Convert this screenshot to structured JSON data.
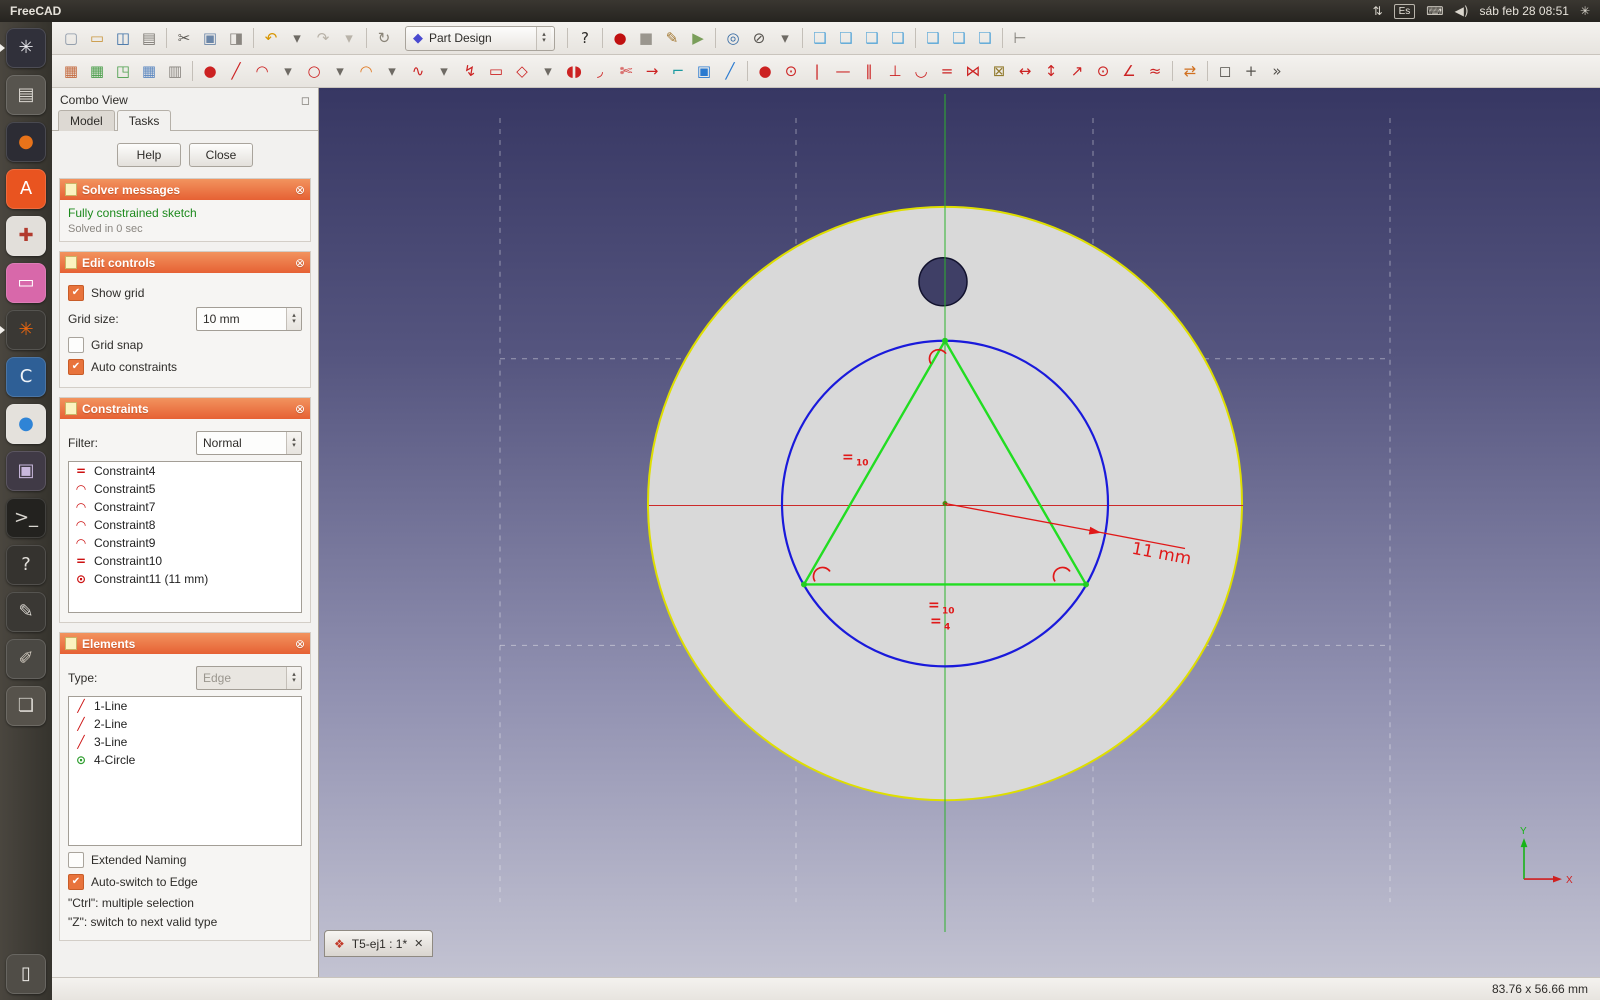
{
  "system_bar": {
    "app_title": "FreeCAD",
    "network_glyph": "⇅",
    "keyboard_layout": "Es",
    "keyboard_glyph": "⌨",
    "volume_glyph": "◀)",
    "clock": "sáb feb 28 08:51",
    "session_glyph": "✳"
  },
  "dock": {
    "items": [
      {
        "name": "freecad-launcher",
        "icon": "freecad-icon",
        "glyph": "✳",
        "fg": "#e8e8ec",
        "bg": "#30303a",
        "running": true
      },
      {
        "name": "file-manager-launcher",
        "icon": "file-manager-icon",
        "glyph": "▤",
        "fg": "#d8d5cf",
        "bg": "#57544e",
        "running": false
      },
      {
        "name": "firefox-launcher",
        "icon": "firefox-icon",
        "glyph": "●",
        "fg": "#e8731a",
        "bg": "#2c2c34",
        "running": false
      },
      {
        "name": "software-center-launcher",
        "icon": "software-center-icon",
        "glyph": "A",
        "fg": "#ffffff",
        "bg": "#e95420",
        "running": false
      },
      {
        "name": "system-tools-launcher",
        "icon": "tools-icon",
        "glyph": "✚",
        "fg": "#b23b2e",
        "bg": "#e2dfda",
        "running": false
      },
      {
        "name": "media-app-launcher",
        "icon": "media-app-icon",
        "glyph": "▭",
        "fg": "#ffffff",
        "bg": "#d868aa",
        "running": false
      },
      {
        "name": "settings-gear-launcher",
        "icon": "gear-icon",
        "glyph": "✳",
        "fg": "#e8650f",
        "bg": "#3a3834",
        "running": true
      },
      {
        "name": "chromium-launcher",
        "icon": "chromium-icon",
        "glyph": "C",
        "fg": "#eef3f8",
        "bg": "#2e5f96",
        "running": false
      },
      {
        "name": "browser-launcher",
        "icon": "globe-icon",
        "glyph": "●",
        "fg": "#2f84d6",
        "bg": "#e4e1dc",
        "running": false
      },
      {
        "name": "screenshot-tool-launcher",
        "icon": "screenshot-icon",
        "glyph": "▣",
        "fg": "#c9b8dd",
        "bg": "#403a46",
        "running": false
      },
      {
        "name": "terminal-launcher",
        "icon": "terminal-icon",
        "glyph": ">_",
        "fg": "#d8d5cf",
        "bg": "#23221f",
        "running": false
      },
      {
        "name": "help-launcher",
        "icon": "help-icon",
        "glyph": "?",
        "fg": "#e2dfda",
        "bg": "#35332f",
        "running": false
      },
      {
        "name": "text-editor-launcher",
        "icon": "pencil-icon",
        "glyph": "✎",
        "fg": "#d8d5cf",
        "bg": "#3a3834",
        "running": false
      },
      {
        "name": "gimp-launcher",
        "icon": "paintbrush-icon",
        "glyph": "✐",
        "fg": "#cfc8bd",
        "bg": "#4a4843",
        "running": false
      },
      {
        "name": "workspace-switcher-launcher",
        "icon": "workspace-icon",
        "glyph": "❏",
        "fg": "#dad7d1",
        "bg": "#56524b",
        "running": false
      },
      {
        "name": "trash-launcher",
        "icon": "trash-icon",
        "glyph": "▯",
        "fg": "#eceae6",
        "bg": "#504d47",
        "running": false
      }
    ]
  },
  "toolbars": {
    "workbench_selector": {
      "icon_glyph": "◆",
      "value": "Part Design"
    },
    "main_a": [
      {
        "name": "new-document-button",
        "icon": "new-document-icon",
        "glyph": "▢",
        "color": "#8a96a6"
      },
      {
        "name": "open-document-button",
        "icon": "open-folder-icon",
        "glyph": "▭",
        "color": "#c9973f"
      },
      {
        "name": "save-document-button",
        "icon": "save-icon",
        "glyph": "◫",
        "color": "#3b6ea5"
      },
      {
        "name": "print-button",
        "icon": "printer-icon",
        "glyph": "▤",
        "color": "#7d7a74"
      },
      {
        "name": "cut-button",
        "icon": "scissors-icon",
        "glyph": "✂",
        "color": "#5a5752",
        "sep": true
      },
      {
        "name": "copy-button",
        "icon": "copy-icon",
        "glyph": "▣",
        "color": "#6b86a8"
      },
      {
        "name": "paste-button",
        "icon": "paste-icon",
        "glyph": "◨",
        "color": "#8a8680"
      },
      {
        "name": "undo-button",
        "icon": "undo-icon",
        "glyph": "↶",
        "color": "#d79500",
        "sep": true
      },
      {
        "name": "undo-menu-button",
        "icon": "chevron-down-icon",
        "glyph": "▾",
        "color": "#6e6a64"
      },
      {
        "name": "redo-button",
        "icon": "redo-icon",
        "glyph": "↷",
        "color": "#b9b3a9"
      },
      {
        "name": "redo-menu-button",
        "icon": "chevron-down-icon",
        "glyph": "▾",
        "color": "#b9b3a9"
      },
      {
        "name": "refresh-button",
        "icon": "refresh-icon",
        "glyph": "↻",
        "color": "#8a8478",
        "sep": true
      }
    ],
    "main_b": [
      {
        "name": "whats-this-button",
        "icon": "whats-this-icon",
        "glyph": "?",
        "color": "#2e2c29",
        "sep": true
      },
      {
        "name": "macro-record-button",
        "icon": "record-icon",
        "glyph": "●",
        "color": "#c01010",
        "sep": true
      },
      {
        "name": "macro-stop-button",
        "icon": "stop-icon",
        "glyph": "■",
        "color": "#9a968e"
      },
      {
        "name": "macro-edit-button",
        "icon": "macro-edit-icon",
        "glyph": "✎",
        "color": "#a2762f"
      },
      {
        "name": "macro-play-button",
        "icon": "play-icon",
        "glyph": "▶",
        "color": "#7a9e5a"
      },
      {
        "name": "zoom-fit-all-button",
        "icon": "fit-all-icon",
        "glyph": "◎",
        "color": "#3b6ea5",
        "sep": true
      },
      {
        "name": "draw-style-button",
        "icon": "draw-style-icon",
        "glyph": "⊘",
        "color": "#55524d"
      },
      {
        "name": "draw-style-menu-button",
        "icon": "chevron-down-icon",
        "glyph": "▾",
        "color": "#6e6a64"
      },
      {
        "name": "view-isometric-button",
        "icon": "cube-isometric-icon",
        "glyph": "❑",
        "color": "#58a6d8",
        "sep": true
      },
      {
        "name": "view-front-button",
        "icon": "cube-front-icon",
        "glyph": "❑",
        "color": "#58a6d8"
      },
      {
        "name": "view-top-button",
        "icon": "cube-top-icon",
        "glyph": "❑",
        "color": "#58a6d8"
      },
      {
        "name": "view-right-button",
        "icon": "cube-right-icon",
        "glyph": "❑",
        "color": "#58a6d8"
      },
      {
        "name": "view-rear-button",
        "icon": "cube-rear-icon",
        "glyph": "❑",
        "color": "#58a6d8",
        "sep": true
      },
      {
        "name": "view-bottom-button",
        "icon": "cube-bottom-icon",
        "glyph": "❑",
        "color": "#58a6d8"
      },
      {
        "name": "view-left-button",
        "icon": "cube-left-icon",
        "glyph": "❑",
        "color": "#58a6d8"
      },
      {
        "name": "measure-distance-button",
        "icon": "measure-icon",
        "glyph": "⊢",
        "color": "#7d7a74",
        "sep": true
      }
    ],
    "sketcher": [
      {
        "name": "create-sketch-button",
        "icon": "create-sketch-icon",
        "glyph": "▦",
        "color": "#c46a3f"
      },
      {
        "name": "edit-sketch-button",
        "icon": "edit-sketch-icon",
        "glyph": "▦",
        "color": "#4a9e4a"
      },
      {
        "name": "leave-sketch-button",
        "icon": "leave-sketch-icon",
        "glyph": "◳",
        "color": "#4a9e4a"
      },
      {
        "name": "view-sketch-button",
        "icon": "view-sketch-icon",
        "glyph": "▦",
        "color": "#5b87c0"
      },
      {
        "name": "map-sketch-button",
        "icon": "map-sketch-icon",
        "glyph": "▥",
        "color": "#8a8680"
      },
      {
        "name": "create-point-button",
        "icon": "point-icon",
        "glyph": "●",
        "color": "#cc2222",
        "sep": true
      },
      {
        "name": "create-line-button",
        "icon": "line-icon",
        "glyph": "╱",
        "color": "#cc2222"
      },
      {
        "name": "create-arc-button",
        "icon": "arc-icon",
        "glyph": "◠",
        "color": "#cc2222"
      },
      {
        "name": "arc-tools-menu",
        "icon": "chevron-down-icon",
        "glyph": "▾",
        "color": "#6e6a64"
      },
      {
        "name": "create-circle-button",
        "icon": "circle-icon",
        "glyph": "○",
        "color": "#cc2222"
      },
      {
        "name": "circle-tools-menu",
        "icon": "chevron-down-icon",
        "glyph": "▾",
        "color": "#6e6a64"
      },
      {
        "name": "create-conic-button",
        "icon": "conic-icon",
        "glyph": "◠",
        "color": "#e07820"
      },
      {
        "name": "conic-tools-menu",
        "icon": "chevron-down-icon",
        "glyph": "▾",
        "color": "#6e6a64"
      },
      {
        "name": "create-bspline-button",
        "icon": "bspline-icon",
        "glyph": "∿",
        "color": "#cc2222"
      },
      {
        "name": "bspline-tools-menu",
        "icon": "chevron-down-icon",
        "glyph": "▾",
        "color": "#6e6a64"
      },
      {
        "name": "create-polyline-button",
        "icon": "polyline-icon",
        "glyph": "↯",
        "color": "#cc2222"
      },
      {
        "name": "create-rectangle-button",
        "icon": "rectangle-icon",
        "glyph": "▭",
        "color": "#cc2222"
      },
      {
        "name": "create-polygon-button",
        "icon": "polygon-icon",
        "glyph": "◇",
        "color": "#cc2222"
      },
      {
        "name": "polygon-tools-menu",
        "icon": "chevron-down-icon",
        "glyph": "▾",
        "color": "#6e6a64"
      },
      {
        "name": "create-slot-button",
        "icon": "slot-icon",
        "glyph": "◖◗",
        "color": "#cc2222"
      },
      {
        "name": "create-fillet-button",
        "icon": "fillet-icon",
        "glyph": "◞",
        "color": "#cc2222"
      },
      {
        "name": "trim-edge-button",
        "icon": "trim-icon",
        "glyph": "✄",
        "color": "#cc2222"
      },
      {
        "name": "extend-edge-button",
        "icon": "extend-icon",
        "glyph": "→",
        "color": "#cc2222"
      },
      {
        "name": "external-geometry-button",
        "icon": "external-geometry-icon",
        "glyph": "⌐",
        "color": "#1a9aa0"
      },
      {
        "name": "carbon-copy-button",
        "icon": "carbon-copy-icon",
        "glyph": "▣",
        "color": "#2a7ad0"
      },
      {
        "name": "construction-mode-button",
        "icon": "construction-mode-icon",
        "glyph": "╱",
        "color": "#2a7ad0"
      },
      {
        "name": "constrain-coincident-button",
        "icon": "coincident-icon",
        "glyph": "●",
        "color": "#cc2222",
        "sep": true
      },
      {
        "name": "constrain-point-on-object-button",
        "icon": "point-on-object-icon",
        "glyph": "⊙",
        "color": "#cc2222"
      },
      {
        "name": "constrain-vertical-button",
        "icon": "vertical-constraint-icon",
        "glyph": "|",
        "color": "#cc2222"
      },
      {
        "name": "constrain-horizontal-button",
        "icon": "horizontal-constraint-icon",
        "glyph": "—",
        "color": "#cc2222"
      },
      {
        "name": "constrain-parallel-button",
        "icon": "parallel-icon",
        "glyph": "∥",
        "color": "#cc2222"
      },
      {
        "name": "constrain-perpendicular-button",
        "icon": "perpendicular-icon",
        "glyph": "⊥",
        "color": "#cc2222"
      },
      {
        "name": "constrain-tangent-button",
        "icon": "tangent-icon",
        "glyph": "◡",
        "color": "#cc2222"
      },
      {
        "name": "constrain-equal-button",
        "icon": "equal-icon",
        "glyph": "=",
        "color": "#cc2222"
      },
      {
        "name": "constrain-symmetric-button",
        "icon": "symmetric-icon",
        "glyph": "⋈",
        "color": "#cc2222"
      },
      {
        "name": "constrain-lock-button",
        "icon": "lock-icon",
        "glyph": "⊠",
        "color": "#937b2f"
      },
      {
        "name": "constrain-horizontal-distance-button",
        "icon": "horizontal-distance-icon",
        "glyph": "↔",
        "color": "#cc2222"
      },
      {
        "name": "constrain-vertical-distance-button",
        "icon": "vertical-distance-icon",
        "glyph": "↕",
        "color": "#cc2222"
      },
      {
        "name": "constrain-distance-button",
        "icon": "distance-icon",
        "glyph": "↗",
        "color": "#cc2222"
      },
      {
        "name": "constrain-radius-button",
        "icon": "radius-icon",
        "glyph": "⊙",
        "color": "#cc2222"
      },
      {
        "name": "constrain-angle-button",
        "icon": "angle-icon",
        "glyph": "∠",
        "color": "#cc2222"
      },
      {
        "name": "constrain-refraction-button",
        "icon": "refraction-icon",
        "glyph": "≈",
        "color": "#cc2222"
      },
      {
        "name": "toggle-driving-constraint-button",
        "icon": "driving-constraint-icon",
        "glyph": "⇄",
        "color": "#d07020",
        "sep": true
      },
      {
        "name": "select-constraints-button",
        "icon": "select-constraints-icon",
        "glyph": "◻",
        "color": "#55524d",
        "sep": true
      },
      {
        "name": "select-elements-button",
        "icon": "select-elements-icon",
        "glyph": "+",
        "color": "#55524d"
      },
      {
        "name": "toolbar-overflow-button",
        "icon": "overflow-icon",
        "glyph": "»",
        "color": "#55524d"
      }
    ]
  },
  "combo_view": {
    "title": "Combo View",
    "options_glyph": "◻",
    "tabs": {
      "model": "Model",
      "tasks": "Tasks"
    },
    "help_button": "Help",
    "close_button": "Close",
    "solver": {
      "header": "Solver messages",
      "status": "Fully constrained sketch",
      "detail": "Solved in 0 sec"
    },
    "edit_controls": {
      "header": "Edit controls",
      "show_grid": {
        "label": "Show grid",
        "checked": true
      },
      "grid_size": {
        "label": "Grid size:",
        "value": "10 mm"
      },
      "grid_snap": {
        "label": "Grid snap",
        "checked": false
      },
      "auto_constraints": {
        "label": "Auto constraints",
        "checked": true
      }
    },
    "constraints": {
      "header": "Constraints",
      "filter_label": "Filter:",
      "filter_value": "Normal",
      "items": [
        {
          "icon": "equal-constraint-icon",
          "glyph": "=",
          "color": "#cc1111",
          "label": "Constraint4"
        },
        {
          "icon": "tangent-constraint-icon",
          "glyph": "◠",
          "color": "#cc1111",
          "label": "Constraint5"
        },
        {
          "icon": "tangent-constraint-icon",
          "glyph": "◠",
          "color": "#cc1111",
          "label": "Constraint7"
        },
        {
          "icon": "tangent-constraint-icon",
          "glyph": "◠",
          "color": "#cc1111",
          "label": "Constraint8"
        },
        {
          "icon": "tangent-constraint-icon",
          "glyph": "◠",
          "color": "#cc1111",
          "label": "Constraint9"
        },
        {
          "icon": "equal-constraint-icon",
          "glyph": "=",
          "color": "#cc1111",
          "label": "Constraint10"
        },
        {
          "icon": "radius-constraint-icon",
          "glyph": "⊙",
          "color": "#cc1111",
          "label": "Constraint11 (11 mm)"
        }
      ]
    },
    "elements": {
      "header": "Elements",
      "type_label": "Type:",
      "type_value": "Edge",
      "items": [
        {
          "icon": "line-icon",
          "glyph": "╱",
          "color": "#cc1111",
          "label": "1-Line"
        },
        {
          "icon": "line-icon",
          "glyph": "╱",
          "color": "#cc1111",
          "label": "2-Line"
        },
        {
          "icon": "line-icon",
          "glyph": "╱",
          "color": "#cc1111",
          "label": "3-Line"
        },
        {
          "icon": "circle-icon",
          "glyph": "⊙",
          "color": "#2f9e2f",
          "label": "4-Circle"
        }
      ],
      "extended_naming": {
        "label": "Extended Naming",
        "checked": false
      },
      "auto_switch": {
        "label": "Auto-switch to Edge",
        "checked": true
      },
      "hint_ctrl": "\"Ctrl\": multiple selection",
      "hint_z": "\"Z\": switch to next valid type"
    }
  },
  "viewport": {
    "document_tab": {
      "icon_glyph": "❖",
      "label": "T5-ej1 : 1*",
      "close_glyph": "✕"
    },
    "dimension_label": "11 mm",
    "equal_badge_1": "10",
    "equal_badge_2": "10",
    "equal_badge_3": "4",
    "axis_x": "X",
    "axis_y": "Y",
    "colors": {
      "face_edge": "#dede00",
      "construction_circle": "#1a1adb",
      "constrained_geometry": "#22dd22",
      "constraint_red": "#e01818",
      "axis_x_red": "#cc2a2a",
      "axis_y_green": "#2db22d"
    }
  },
  "status_bar": {
    "viewport_size": "83.76 x 56.66 mm"
  }
}
